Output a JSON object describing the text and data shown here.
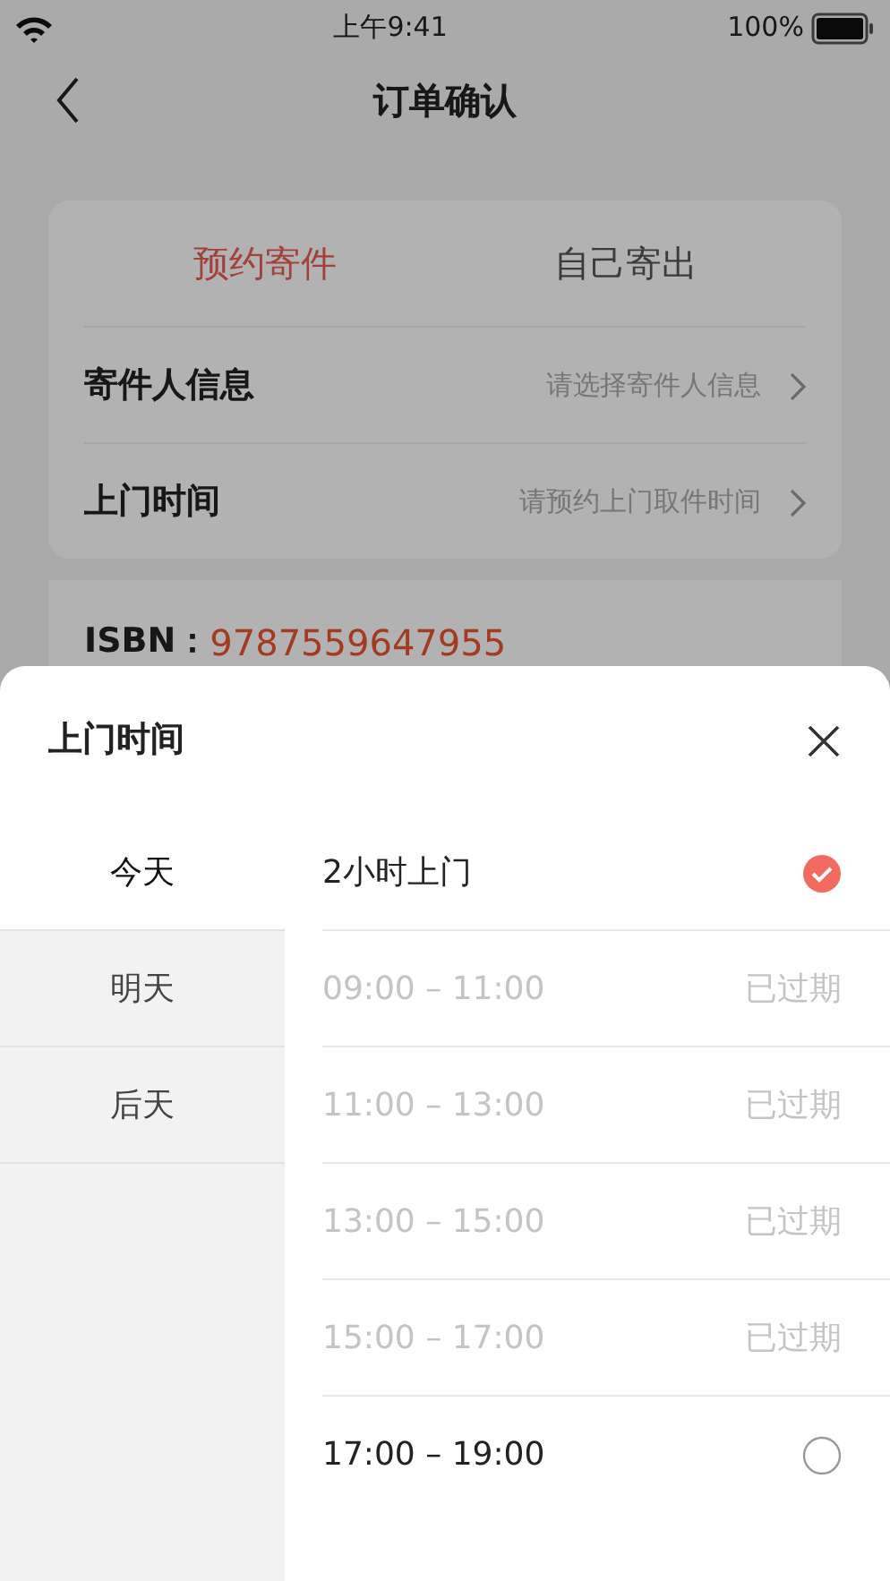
{
  "status_bar": {
    "time": "上午9:41",
    "battery": "100%"
  },
  "nav": {
    "title": "订单确认"
  },
  "mode_tabs": [
    {
      "label": "预约寄件",
      "selected": true
    },
    {
      "label": "自己寄出",
      "selected": false
    }
  ],
  "form_rows": [
    {
      "label": "寄件人信息",
      "placeholder": "请选择寄件人信息"
    },
    {
      "label": "上门时间",
      "placeholder": "请预约上门取件时间"
    }
  ],
  "isbn": {
    "label": "ISBN：",
    "value": "9787559647955"
  },
  "sheet": {
    "title": "上门时间",
    "days": [
      {
        "label": "今天",
        "selected": true
      },
      {
        "label": "明天",
        "selected": false
      },
      {
        "label": "后天",
        "selected": false
      }
    ],
    "slots": [
      {
        "label": "2小时上门",
        "disabled": false,
        "selected": true
      },
      {
        "label": "09:00 – 11:00",
        "disabled": true,
        "status": "已过期"
      },
      {
        "label": "11:00 – 13:00",
        "disabled": true,
        "status": "已过期"
      },
      {
        "label": "13:00 – 15:00",
        "disabled": true,
        "status": "已过期"
      },
      {
        "label": "15:00 – 17:00",
        "disabled": true,
        "status": "已过期"
      },
      {
        "label": "17:00 – 19:00",
        "disabled": false,
        "selected": false
      }
    ]
  }
}
